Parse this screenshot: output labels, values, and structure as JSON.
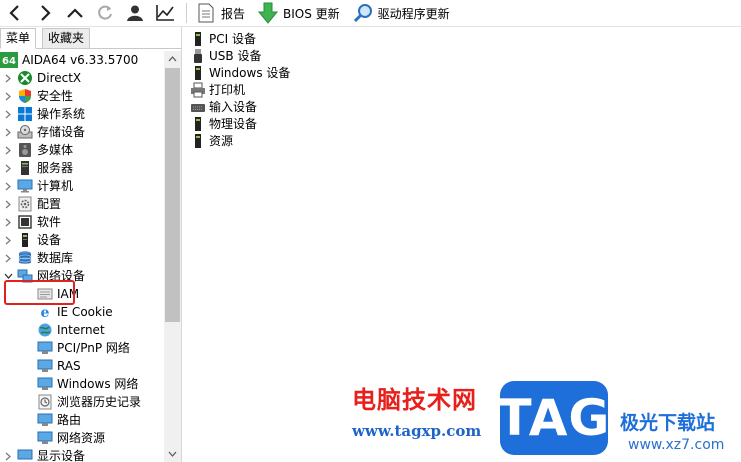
{
  "toolbar": {
    "report_label": "报告",
    "bios_label": "BIOS 更新",
    "driver_label": "驱动程序更新"
  },
  "tabs": {
    "menu": "菜单",
    "favorites": "收藏夹"
  },
  "tree": {
    "root": "AIDA64 v6.33.5700",
    "items": [
      {
        "label": "DirectX",
        "icon": "xbox-icon"
      },
      {
        "label": "安全性",
        "icon": "shield-icon"
      },
      {
        "label": "操作系统",
        "icon": "windows-icon"
      },
      {
        "label": "存储设备",
        "icon": "storage-icon"
      },
      {
        "label": "多媒体",
        "icon": "multimedia-icon"
      },
      {
        "label": "服务器",
        "icon": "server-icon"
      },
      {
        "label": "计算机",
        "icon": "computer-icon"
      },
      {
        "label": "配置",
        "icon": "config-icon"
      },
      {
        "label": "软件",
        "icon": "software-icon"
      },
      {
        "label": "设备",
        "icon": "device-icon"
      },
      {
        "label": "数据库",
        "icon": "database-icon"
      },
      {
        "label": "网络设备",
        "icon": "network-icon"
      }
    ],
    "network_children": [
      {
        "label": "IAM",
        "icon": "iam-icon"
      },
      {
        "label": "IE Cookie",
        "icon": "ie-icon"
      },
      {
        "label": "Internet",
        "icon": "internet-icon"
      },
      {
        "label": "PCI/PnP 网络",
        "icon": "pci-network-icon"
      },
      {
        "label": "RAS",
        "icon": "ras-icon"
      },
      {
        "label": "Windows 网络",
        "icon": "windows-network-icon"
      },
      {
        "label": "浏览器历史记录",
        "icon": "browser-history-icon"
      },
      {
        "label": "路由",
        "icon": "route-icon"
      },
      {
        "label": "网络资源",
        "icon": "network-resource-icon"
      }
    ],
    "partial": "显示设备"
  },
  "right": {
    "items": [
      {
        "label": "PCI 设备",
        "icon": "pci-device-icon"
      },
      {
        "label": "USB 设备",
        "icon": "usb-icon"
      },
      {
        "label": "Windows 设备",
        "icon": "windows-device-icon"
      },
      {
        "label": "打印机",
        "icon": "printer-icon"
      },
      {
        "label": "输入设备",
        "icon": "input-device-icon"
      },
      {
        "label": "物理设备",
        "icon": "physical-device-icon"
      },
      {
        "label": "资源",
        "icon": "resource-icon"
      }
    ]
  },
  "watermark": {
    "text": "电脑技术网",
    "url": "www.tagxp.com",
    "logo": "TAG",
    "site": "极光下载站",
    "site_url": "www.xz7.com"
  },
  "colors": {
    "highlight": "#e0211f",
    "accent_blue": "#1e6fd9",
    "watermark_red": "#e8201c"
  }
}
